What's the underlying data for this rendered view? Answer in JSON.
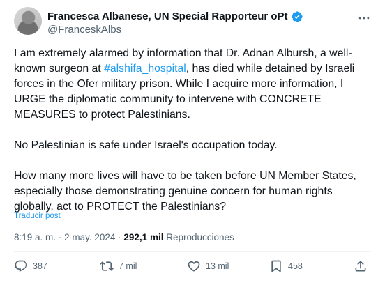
{
  "author": {
    "name": "Francesca Albanese, UN Special Rapporteur oPt",
    "handle": "@FranceskAlbs",
    "verified": true
  },
  "tweet": {
    "p1_before": "I am extremely alarmed by information that Dr. Adnan Albursh, a well-known surgeon at ",
    "hashtag": "#alshifa_hospital",
    "p1_after": ", has died while detained by Israeli forces in the Ofer military prison. While I acquire more information, I URGE the diplomatic community to intervene with CONCRETE MEASURES to protect Palestinians.",
    "p2": "No Palestinian is safe under Israel's occupation today.",
    "p3": "How many more lives will have to be taken before UN Member States, especially those demonstrating genuine concern for human rights globally, act to PROTECT the Palestinians?",
    "translate_label": "Traducir post"
  },
  "meta": {
    "time": "8:19 a. m.",
    "separator": "·",
    "date": "2 may. 2024",
    "views_count": "292,1 mil",
    "views_label": "Reproducciones"
  },
  "actions": {
    "replies": "387",
    "reposts": "7 mil",
    "likes": "13 mil",
    "bookmarks": "458"
  },
  "icons": [
    "avatar",
    "verified-icon",
    "more-icon",
    "reply-icon",
    "retweet-icon",
    "like-icon",
    "bookmark-icon",
    "share-icon"
  ],
  "colors": {
    "accent": "#1d9bf0",
    "secondary_text": "#536471",
    "text": "#0f1419"
  }
}
